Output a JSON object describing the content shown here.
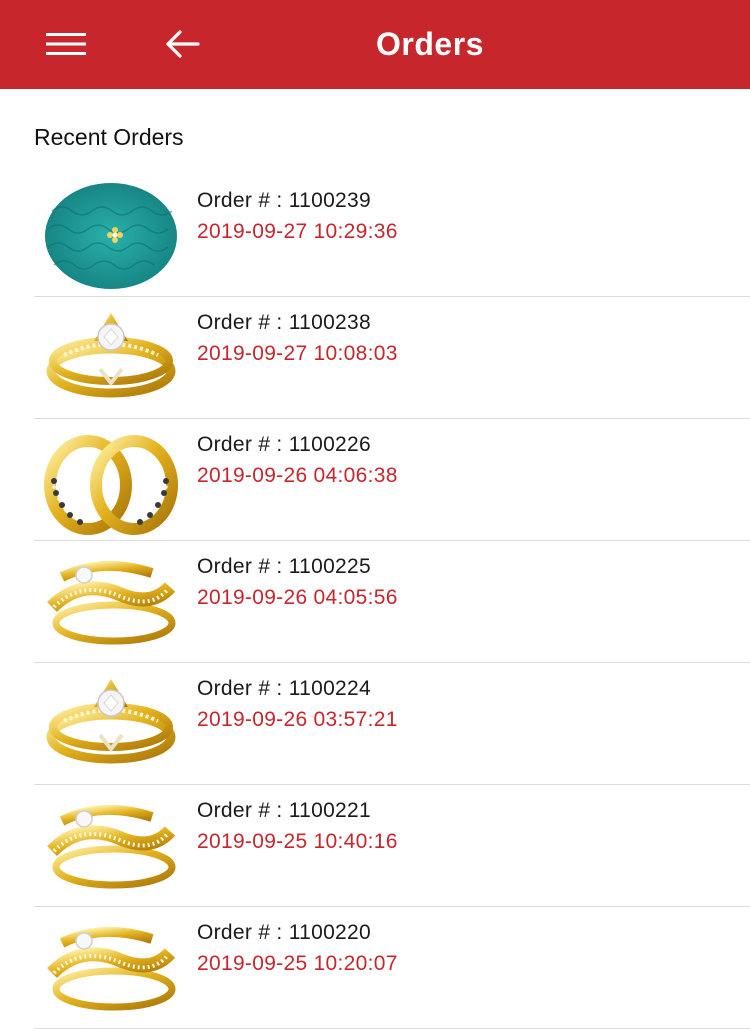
{
  "header": {
    "title": "Orders",
    "menu_icon": "hamburger-menu-icon",
    "back_icon": "arrow-left-icon",
    "background_color": "#c8262d"
  },
  "section": {
    "title": "Recent Orders"
  },
  "accent_color": "#c8262d",
  "orders": [
    {
      "number": "Order # : 1100239",
      "date": "2019-09-27 10:29:36",
      "image": "nose-stud-on-teal-fabric"
    },
    {
      "number": "Order # : 1100238",
      "date": "2019-09-27 10:08:03",
      "image": "gold-diamond-bridal-ring-set"
    },
    {
      "number": "Order # : 1100226",
      "date": "2019-09-26 04:06:38",
      "image": "interlocked-gold-wedding-bands"
    },
    {
      "number": "Order # : 1100225",
      "date": "2019-09-26 04:05:56",
      "image": "gold-swirl-diamond-ring-set"
    },
    {
      "number": "Order # : 1100224",
      "date": "2019-09-26 03:57:21",
      "image": "gold-diamond-bridal-ring-set"
    },
    {
      "number": "Order # : 1100221",
      "date": "2019-09-25 10:40:16",
      "image": "gold-swirl-diamond-ring-set"
    },
    {
      "number": "Order # : 1100220",
      "date": "2019-09-25 10:20:07",
      "image": "gold-swirl-diamond-ring-set"
    }
  ]
}
